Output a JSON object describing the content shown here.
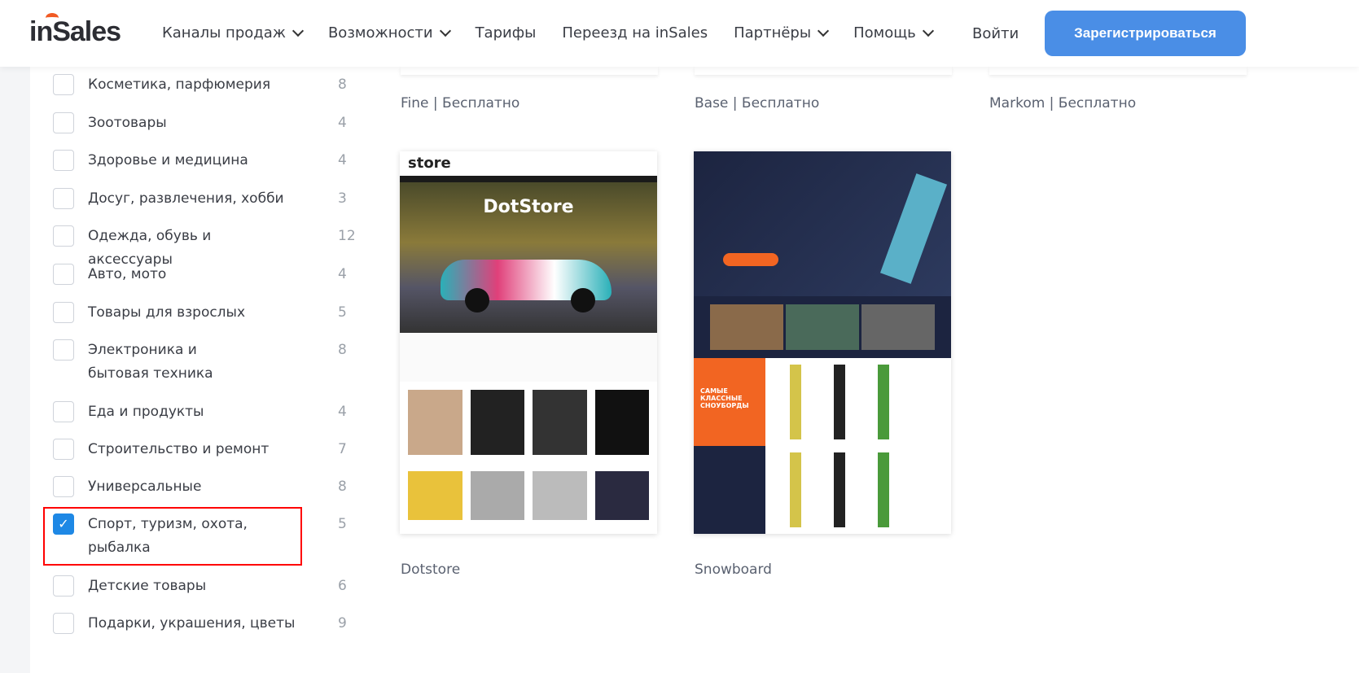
{
  "header": {
    "logo": "inSales",
    "nav": [
      {
        "label": "Каналы продаж",
        "dropdown": true
      },
      {
        "label": "Возможности",
        "dropdown": true
      },
      {
        "label": "Тарифы",
        "dropdown": false
      },
      {
        "label": "Переезд на inSales",
        "dropdown": false
      },
      {
        "label": "Партнёры",
        "dropdown": true
      },
      {
        "label": "Помощь",
        "dropdown": true
      }
    ],
    "login": "Войти",
    "register": "Зарегистрироваться",
    "accent": "#4a8ee6"
  },
  "sidebar": {
    "categories": [
      {
        "label": "Косметика, парфюмерия",
        "count": "8",
        "checked": false
      },
      {
        "label": "Зоотовары",
        "count": "4",
        "checked": false
      },
      {
        "label": "Здоровье и медицина",
        "count": "4",
        "checked": false
      },
      {
        "label": "Досуг, развлечения, хобби",
        "count": "3",
        "checked": false
      },
      {
        "label": "Одежда, обувь и аксессуары",
        "count": "12",
        "checked": false
      },
      {
        "label": "Авто, мото",
        "count": "4",
        "checked": false
      },
      {
        "label": "Товары для взрослых",
        "count": "5",
        "checked": false
      },
      {
        "label": "Электроника и бытовая техника",
        "count": "8",
        "checked": false
      },
      {
        "label": "Еда и продукты",
        "count": "4",
        "checked": false
      },
      {
        "label": "Строительство и ремонт",
        "count": "7",
        "checked": false
      },
      {
        "label": "Универсальные",
        "count": "8",
        "checked": false
      },
      {
        "label": "Спорт, туризм, охота, рыбалка",
        "count": "5",
        "checked": true
      },
      {
        "label": "Детские товары",
        "count": "6",
        "checked": false
      },
      {
        "label": "Подарки, украшения, цветы",
        "count": "9",
        "checked": false
      }
    ]
  },
  "themes": {
    "top": [
      "Fine | Бесплатно",
      "Base | Бесплатно",
      "Markom | Бесплатно"
    ],
    "cards": [
      {
        "name": "Dotstore",
        "preview_title": "DotStore",
        "logo": "store"
      },
      {
        "name": "Snowboard",
        "preview_title": "САМЫЕ КЛАССНЫЕ СНОУБОРДЫ"
      }
    ]
  }
}
